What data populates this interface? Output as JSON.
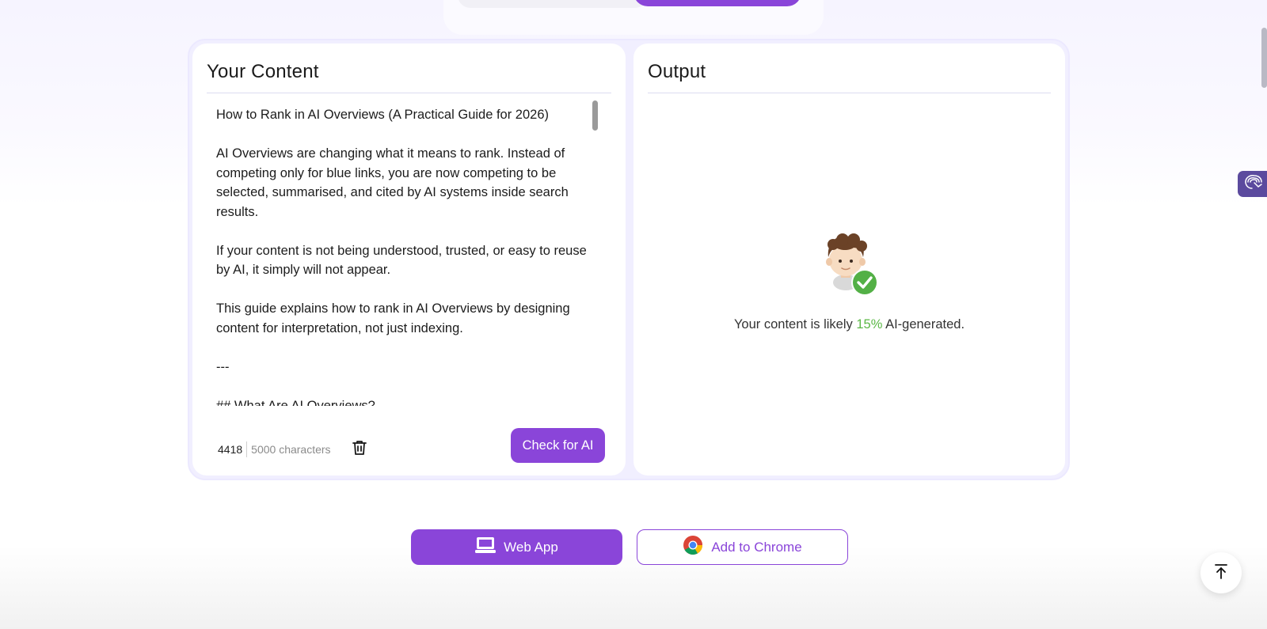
{
  "content_panel": {
    "title": "Your Content",
    "paragraphs": [
      "How to Rank in AI Overviews (A Practical Guide for 2026)",
      "AI Overviews are changing what it means to rank. Instead of competing only for blue links, you are now competing to be selected, summarised, and cited by AI systems inside search results.",
      "If your content is not being understood, trusted, or easy to reuse by AI, it simply will not appear.",
      "This guide explains how to rank in AI Overviews by designing content for interpretation, not just indexing.",
      "---",
      "## What Are AI Overviews?"
    ],
    "char_count": "4418",
    "char_limit": "5000 characters",
    "clear_icon": "trash-icon",
    "check_button": "Check for AI"
  },
  "output_panel": {
    "title": "Output",
    "result_prefix": "Your content is likely",
    "result_percent": "15%",
    "result_suffix": "AI-generated.",
    "result_icon": "human-check-avatar",
    "percent_color": "#5bb846"
  },
  "cta": {
    "web_app_label": "Web App",
    "web_app_icon": "laptop-icon",
    "chrome_label": "Add to Chrome",
    "chrome_icon": "chrome-icon"
  },
  "colors": {
    "accent": "#8a45d9",
    "side_tab": "#5b4a9e"
  },
  "side_tab_icon": "brain-icon",
  "scroll_top_icon": "arrow-up-to-line-icon"
}
